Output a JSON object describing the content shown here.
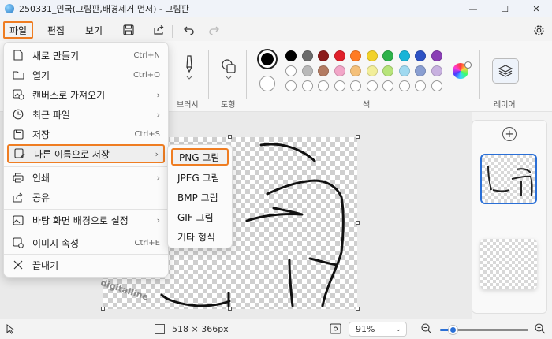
{
  "window": {
    "title": "250331_민국(그림판,배경제거 먼저) - 그림판",
    "minimize": "—",
    "maximize": "☐",
    "close": "✕"
  },
  "menubar": {
    "file": "파일",
    "edit": "편집",
    "view": "보기"
  },
  "ribbon": {
    "brush_label": "브러시",
    "shape_label": "도형",
    "color_label": "색",
    "layer_label": "레이어",
    "colors_row1": [
      "#000000",
      "#6b6b6b",
      "#8b1a1a",
      "#e0202a",
      "#ff7b22",
      "#f2d22a",
      "#2db24a",
      "#18b4d8",
      "#2d52c4",
      "#8a3fb5"
    ],
    "colors_row2": [
      "#ffffff",
      "#b9b9b9",
      "#b37b62",
      "#f2a6c8",
      "#f4c07a",
      "#f2ee9a",
      "#b7e47a",
      "#9fd9f0",
      "#8a9fd2",
      "#c8b1e0"
    ],
    "colors_row3": [
      "#ffffff",
      "#ffffff",
      "#ffffff",
      "#ffffff",
      "#ffffff",
      "#ffffff",
      "#ffffff",
      "#ffffff",
      "#ffffff",
      "#ffffff"
    ]
  },
  "file_menu": {
    "items": [
      {
        "label": "새로 만들기",
        "shortcut": "Ctrl+N",
        "arrow": ""
      },
      {
        "label": "열기",
        "shortcut": "Ctrl+O",
        "arrow": ""
      },
      {
        "label": "캔버스로 가져오기",
        "shortcut": "",
        "arrow": "›"
      },
      {
        "label": "최근 파일",
        "shortcut": "",
        "arrow": "›"
      },
      {
        "label": "저장",
        "shortcut": "Ctrl+S",
        "arrow": ""
      },
      {
        "label": "다른 이름으로 저장",
        "shortcut": "",
        "arrow": "›"
      },
      {
        "label": "인쇄",
        "shortcut": "",
        "arrow": "›"
      },
      {
        "label": "공유",
        "shortcut": "",
        "arrow": ""
      },
      {
        "label": "바탕 화면 배경으로 설정",
        "shortcut": "",
        "arrow": "›"
      },
      {
        "label": "이미지 속성",
        "shortcut": "Ctrl+E",
        "arrow": ""
      },
      {
        "label": "끝내기",
        "shortcut": "",
        "arrow": ""
      }
    ]
  },
  "save_as_submenu": {
    "items": [
      "PNG 그림",
      "JPEG 그림",
      "BMP 그림",
      "GIF 그림",
      "기타 형식"
    ]
  },
  "status": {
    "dimensions": "518 × 366px",
    "zoom": "91%",
    "watermark": "digitalline"
  }
}
